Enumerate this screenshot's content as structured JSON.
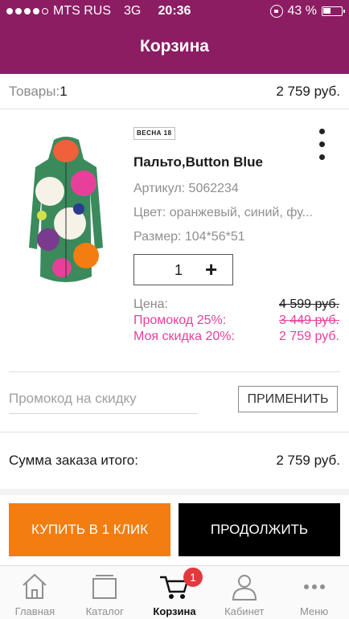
{
  "status_bar": {
    "carrier": "MTS RUS",
    "network": "3G",
    "time": "20:36",
    "battery": "43 %"
  },
  "header": {
    "title": "Корзина"
  },
  "goods": {
    "label": "Товары:",
    "count": "1",
    "total": "2 759 руб."
  },
  "product": {
    "season_badge": "ВЕСНА 18",
    "name": "Пальто,Button Blue",
    "sku": "Артикул: 5062234",
    "color": "Цвет: оранжевый, синий, фу...",
    "size": "Размер: 104*56*51",
    "quantity": "1",
    "price_label": "Цена:",
    "price_original": "4 599 руб.",
    "promo_label": "Промокод 25%:",
    "promo_price": "3 449 руб.",
    "discount_label": "Моя скидка 20%:",
    "discount_price": "2 759 руб."
  },
  "promo": {
    "placeholder": "Промокод на скидку",
    "apply_label": "ПРИМЕНИТЬ"
  },
  "summary": {
    "label": "Сумма заказа итого:",
    "value": "2 759 руб."
  },
  "actions": {
    "buy_one_click": "КУПИТЬ В 1 КЛИК",
    "continue": "ПРОДОЛЖИТЬ"
  },
  "tabs": [
    {
      "label": "Главная",
      "icon": "home-icon"
    },
    {
      "label": "Каталог",
      "icon": "catalog-icon"
    },
    {
      "label": "Корзина",
      "icon": "cart-icon",
      "active": true,
      "badge": "1"
    },
    {
      "label": "Кабинет",
      "icon": "user-icon"
    },
    {
      "label": "Меню",
      "icon": "menu-icon"
    }
  ],
  "colors": {
    "header_bg": "#8c1d63",
    "promo_pink": "#e8409a",
    "buy_button": "#f37d10",
    "continue_button": "#000000",
    "badge": "#e3393e"
  }
}
